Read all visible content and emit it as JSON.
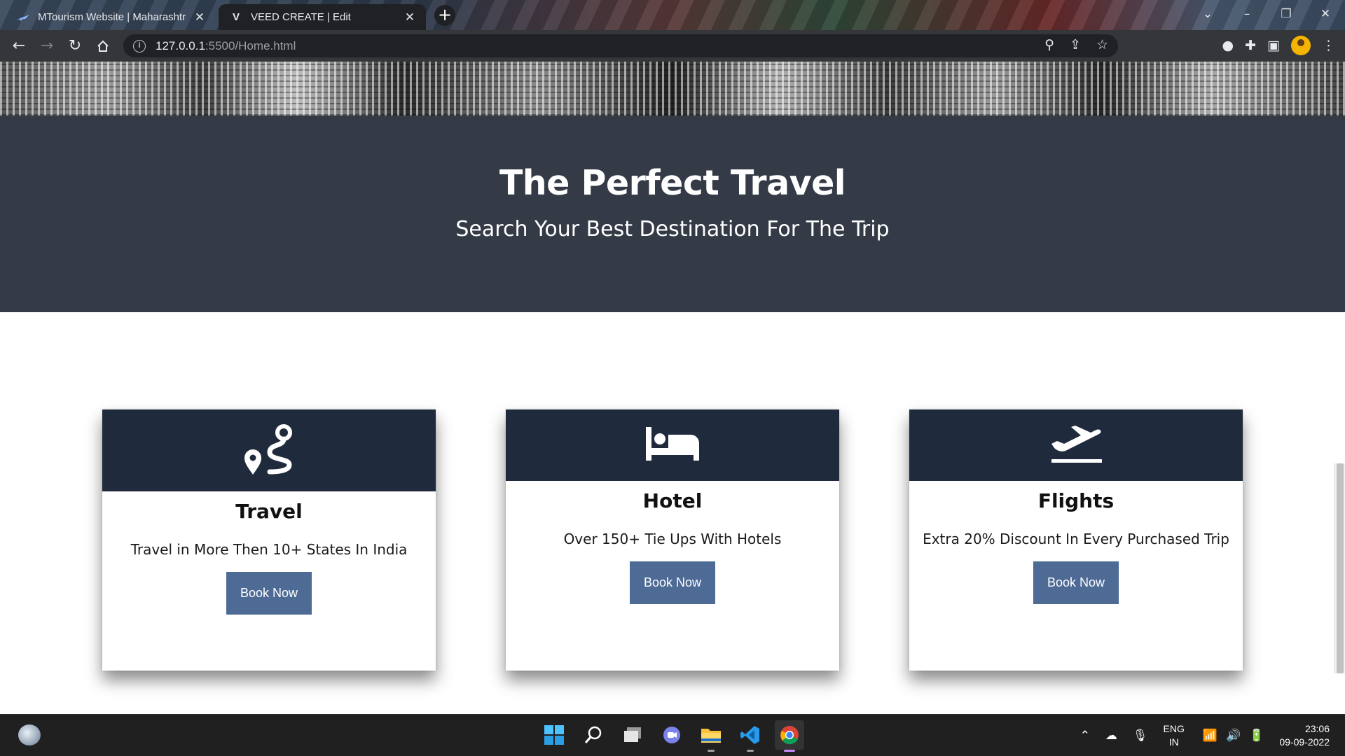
{
  "browser": {
    "tabs": [
      {
        "title": "MTourism Website | Maharashtra",
        "favicon": "plane-favicon-icon",
        "active": false
      },
      {
        "title": "VEED CREATE | Edit",
        "favicon": "V",
        "active": true
      }
    ],
    "new_tab_label": "+",
    "close_glyph": "✕",
    "url_host": "127.0.0.1",
    "url_path": ":5500/Home.html"
  },
  "page": {
    "hero": {
      "title": "The Perfect Travel",
      "subtitle": "Search Your Best Destination For The Trip"
    },
    "cards": [
      {
        "icon": "route-icon",
        "title": "Travel",
        "text": "Travel in More Then 10+ States In India",
        "button": "Book Now"
      },
      {
        "icon": "bed-icon",
        "title": "Hotel",
        "text": "Over 150+ Tie Ups With Hotels",
        "button": "Book Now"
      },
      {
        "icon": "plane-departure-icon",
        "title": "Flights",
        "text": "Extra 20% Discount In Every Purchased Trip",
        "button": "Book Now"
      }
    ],
    "colors": {
      "hero_bg": "#343a46",
      "card_header_bg": "#1f2a3c",
      "button_bg": "#4e6b96"
    }
  },
  "taskbar": {
    "apps": [
      "start-icon",
      "search-icon",
      "task-view-icon",
      "teams-chat-icon",
      "file-explorer-icon",
      "vscode-icon",
      "chrome-icon"
    ],
    "language": {
      "line1": "ENG",
      "line2": "IN"
    },
    "time": "23:06",
    "date": "09-09-2022"
  }
}
